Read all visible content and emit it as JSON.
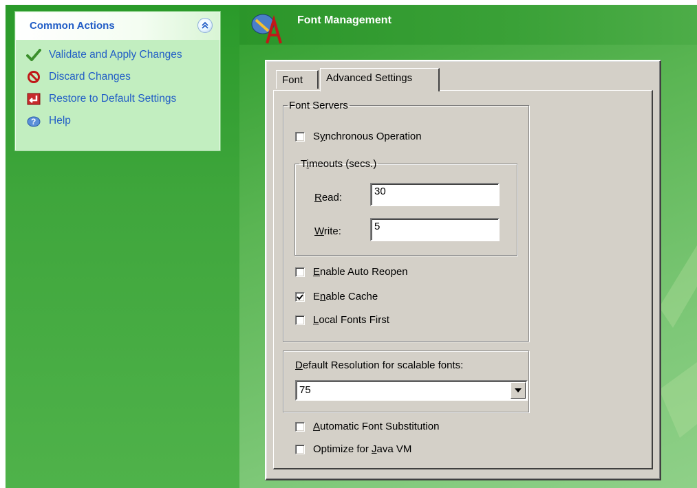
{
  "common_actions": {
    "title": "Common Actions",
    "collapse_glyph": "»",
    "items": [
      {
        "label": "Validate and Apply Changes",
        "icon": "checkmark-icon"
      },
      {
        "label": "Discard Changes",
        "icon": "prohibited-icon"
      },
      {
        "label": "Restore to Default Settings",
        "icon": "restore-icon"
      },
      {
        "label": "Help",
        "icon": "help-icon"
      }
    ]
  },
  "page": {
    "title": "Font Management"
  },
  "tabs": [
    {
      "label": "Font",
      "selected": false
    },
    {
      "label": "Advanced Settings",
      "selected": true
    }
  ],
  "font_servers": {
    "legend": "Font Servers",
    "synchronous": {
      "prefix": "S",
      "accel": "y",
      "rest": "nchronous Operation",
      "checked": false
    },
    "timeouts": {
      "legend_prefix": "T",
      "legend_accel": "i",
      "legend_rest": "meouts (secs.)",
      "read_accel": "R",
      "read_rest": "ead:",
      "read_value": "30",
      "write_accel": "W",
      "write_rest": "rite:",
      "write_value": "5"
    },
    "auto_reopen": {
      "accel": "E",
      "rest": "nable Auto Reopen",
      "checked": false
    },
    "enable_cache": {
      "prefix": "E",
      "accel": "n",
      "rest": "able Cache",
      "checked": true
    },
    "local_fonts_first": {
      "accel": "L",
      "rest": "ocal Fonts First",
      "checked": false
    }
  },
  "resolution": {
    "label_accel": "D",
    "label_rest": "efault Resolution for scalable fonts:",
    "value": "75"
  },
  "auto_substitution": {
    "accel": "A",
    "rest": "utomatic Font Substitution",
    "checked": false
  },
  "java_vm": {
    "prefix": "Optimize for ",
    "accel": "J",
    "rest": "ava VM",
    "checked": false
  },
  "colors": {
    "link": "#215dc6",
    "panel_bg": "#c2eec0",
    "dialog_bg": "#d4d0c8"
  }
}
